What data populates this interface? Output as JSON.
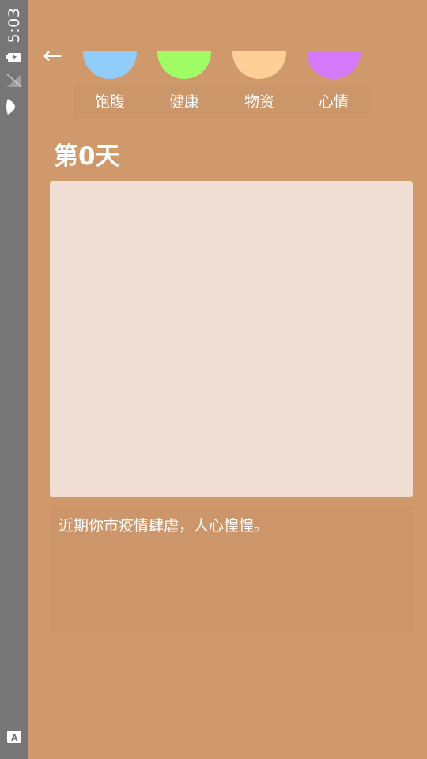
{
  "status_bar": {
    "time": "5:03",
    "icons": [
      "battery-charging-icon",
      "no-sim-icon",
      "wifi-icon",
      "accessibility-icon"
    ]
  },
  "nav": {
    "back_glyph": "←"
  },
  "stats": [
    {
      "label": "饱腹",
      "color": "#90cdfa"
    },
    {
      "label": "健康",
      "color": "#9ffc64"
    },
    {
      "label": "物资",
      "color": "#fecf96"
    },
    {
      "label": "心情",
      "color": "#d479fa"
    }
  ],
  "day": {
    "title": "第0天"
  },
  "story": {
    "text": "近期你市疫情肆虐，人心惶惶。"
  },
  "colors": {
    "background": "#d0996c",
    "panel": "#f0ddd3",
    "statusbar": "#767676"
  }
}
